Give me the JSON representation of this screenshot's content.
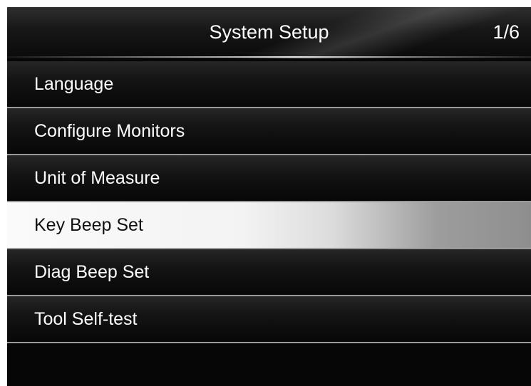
{
  "header": {
    "title": "System Setup",
    "page_indicator": "1/6"
  },
  "menu": {
    "items": [
      {
        "label": "Language",
        "selected": false
      },
      {
        "label": "Configure Monitors",
        "selected": false
      },
      {
        "label": "Unit of Measure",
        "selected": false
      },
      {
        "label": "Key Beep Set",
        "selected": true
      },
      {
        "label": "Diag Beep Set",
        "selected": false
      },
      {
        "label": "Tool Self-test",
        "selected": false
      }
    ]
  },
  "colors": {
    "background": "#060606",
    "text": "#ffffff",
    "selected_text": "#111111",
    "selected_highlight": "#f3f3f3",
    "separator": "#9a9a9a"
  }
}
